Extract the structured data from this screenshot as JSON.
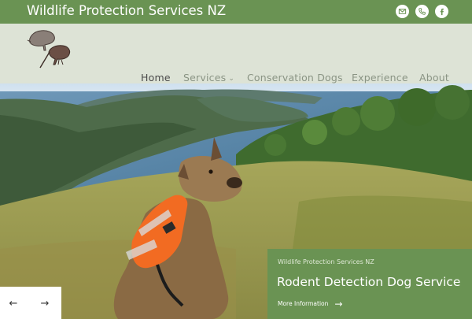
{
  "header": {
    "site_title": "Wildlife Protection Services NZ",
    "social": [
      {
        "name": "email-icon"
      },
      {
        "name": "phone-icon"
      },
      {
        "name": "facebook-icon"
      }
    ]
  },
  "nav": {
    "items": [
      {
        "label": "Home",
        "active": true
      },
      {
        "label": "Services",
        "has_dropdown": true
      },
      {
        "label": "Conservation Dogs"
      },
      {
        "label": "Experience"
      },
      {
        "label": "About"
      }
    ]
  },
  "slide": {
    "kicker": "Wildlife Protection Services NZ",
    "title": "Rodent Detection Dog Service",
    "more_label": "More Information",
    "more_arrow": "→"
  },
  "slider": {
    "prev": "←",
    "next": "→"
  },
  "colors": {
    "brand_green": "#6a9353",
    "nav_bg": "#dde3d6",
    "vest_orange": "#f26b22"
  }
}
